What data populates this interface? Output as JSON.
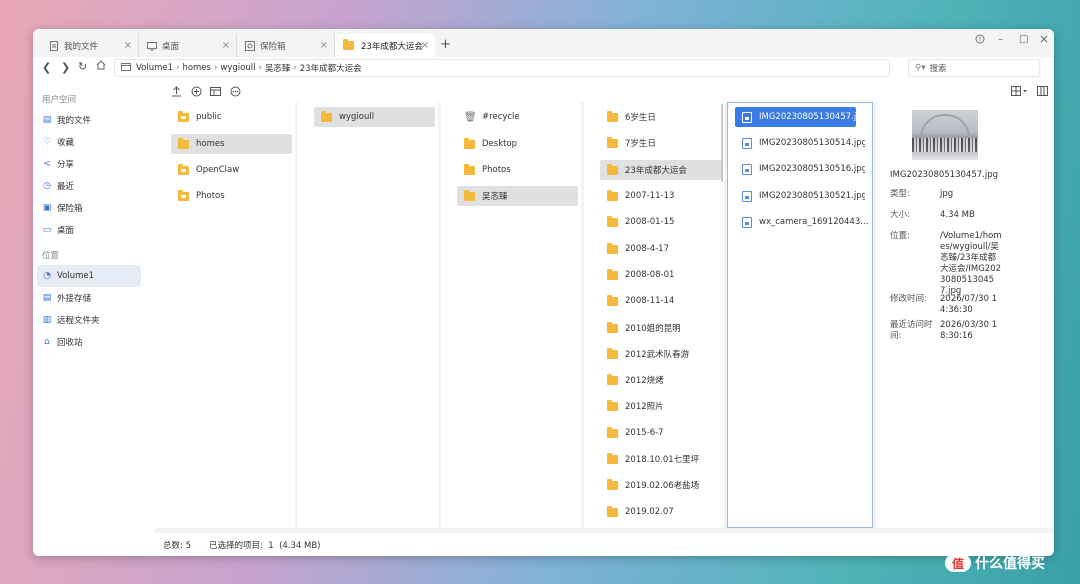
{
  "tabs": [
    {
      "label": "我的文件",
      "active": false
    },
    {
      "label": "桌面",
      "active": false
    },
    {
      "label": "保险箱",
      "active": false
    },
    {
      "label": "23年成都大运会",
      "active": true
    }
  ],
  "window_controls": [
    "?",
    "–",
    "□",
    "×"
  ],
  "breadcrumb": [
    "Volume1",
    "homes",
    "wygioull",
    "吴忞臻",
    "23年成都大运会"
  ],
  "search": {
    "placeholder": "搜索"
  },
  "sidebar": {
    "section_user": "用户空间",
    "user_items": [
      {
        "label": "我的文件",
        "icon": "file-icon"
      },
      {
        "label": "收藏",
        "icon": "heart-icon"
      },
      {
        "label": "分享",
        "icon": "share-icon"
      },
      {
        "label": "最近",
        "icon": "clock-icon"
      },
      {
        "label": "保险箱",
        "icon": "vault-icon"
      },
      {
        "label": "桌面",
        "icon": "desktop-icon"
      }
    ],
    "section_location": "位置",
    "location_items": [
      {
        "label": "Volume1",
        "icon": "volume-icon",
        "active": true
      },
      {
        "label": "外接存储",
        "icon": "external-storage-icon"
      },
      {
        "label": "远程文件夹",
        "icon": "remote-folder-icon"
      },
      {
        "label": "回收站",
        "icon": "trash-icon"
      }
    ]
  },
  "columns": [
    {
      "items": [
        {
          "label": "public",
          "type": "special-folder"
        },
        {
          "label": "homes",
          "type": "folder",
          "selected": true
        },
        {
          "label": "OpenClaw",
          "type": "special-folder"
        },
        {
          "label": "Photos",
          "type": "special-folder"
        }
      ]
    },
    {
      "items": [
        {
          "label": "wygioull",
          "type": "folder",
          "selected": true
        }
      ]
    },
    {
      "items": [
        {
          "label": "#recycle",
          "type": "trash"
        },
        {
          "label": "Desktop",
          "type": "folder"
        },
        {
          "label": "Photos",
          "type": "folder"
        },
        {
          "label": "吴忞臻",
          "type": "folder",
          "selected": true
        }
      ]
    },
    {
      "items": [
        {
          "label": "6岁生日",
          "type": "folder"
        },
        {
          "label": "7岁生日",
          "type": "folder"
        },
        {
          "label": "23年成都大运会",
          "type": "folder",
          "selected": true
        },
        {
          "label": "2007-11-13",
          "type": "folder"
        },
        {
          "label": "2008-01-15",
          "type": "folder"
        },
        {
          "label": "2008-4-17",
          "type": "folder"
        },
        {
          "label": "2008-08-01",
          "type": "folder"
        },
        {
          "label": "2008-11-14",
          "type": "folder"
        },
        {
          "label": "2010姐的昆明",
          "type": "folder"
        },
        {
          "label": "2012武术队春游",
          "type": "folder"
        },
        {
          "label": "2012烧烤",
          "type": "folder"
        },
        {
          "label": "2012照片",
          "type": "folder"
        },
        {
          "label": "2015-6-7",
          "type": "folder"
        },
        {
          "label": "2018.10.01七里坪",
          "type": "folder"
        },
        {
          "label": "2019.02.06老盐场",
          "type": "folder"
        },
        {
          "label": "2019.02.07",
          "type": "folder"
        }
      ]
    },
    {
      "items": [
        {
          "label": "IMG20230805130457.jpg",
          "type": "image",
          "selected": true
        },
        {
          "label": "IMG20230805130514.jpg",
          "type": "image"
        },
        {
          "label": "IMG20230805130516.jpg",
          "type": "image"
        },
        {
          "label": "IMG20230805130521.jpg",
          "type": "image"
        },
        {
          "label": "wx_camera_169120443...",
          "type": "image"
        }
      ]
    }
  ],
  "detail": {
    "filename": "IMG20230805130457.jpg",
    "rows": [
      {
        "label": "类型:",
        "value": "jpg"
      },
      {
        "label": "大小:",
        "value": "4.34 MB"
      },
      {
        "label": "位置:",
        "value": "/Volume1/homes/wygioull/吴忞臻/23年成都大运会/IMG20230805130457.jpg"
      },
      {
        "label": "修改时间:",
        "value": "2026/07/30 14:36:30"
      },
      {
        "label": "最近访问时间:",
        "value": "2026/03/30 18:30:16"
      }
    ]
  },
  "status": {
    "total": "总数: 5",
    "selected": "已选择的项目:  1  (4.34 MB)"
  },
  "watermark": {
    "badge": "值",
    "text": "什么值得买"
  }
}
